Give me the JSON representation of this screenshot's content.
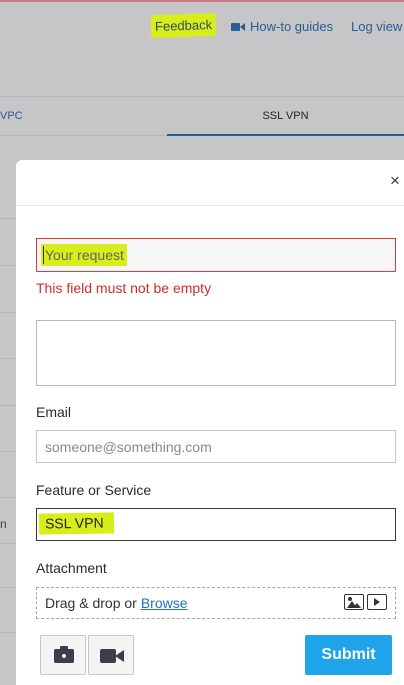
{
  "header": {
    "links": {
      "feedback": "Feedback",
      "guides": "How-to guides",
      "log": "Log view"
    }
  },
  "tabs": {
    "vpc": "VPC",
    "ssl_vpn": "SSL VPN"
  },
  "background": {
    "partial_text": "n"
  },
  "modal": {
    "close_symbol": "×",
    "request": {
      "placeholder": "Your request",
      "error": "This field must not be empty"
    },
    "description": {
      "value": ""
    },
    "email": {
      "label": "Email",
      "placeholder": "someone@something.com"
    },
    "feature": {
      "label": "Feature or Service",
      "value": "SSL VPN"
    },
    "attachment": {
      "label": "Attachment",
      "drop_text": "Drag & drop or",
      "browse": "Browse"
    },
    "submit_label": "Submit"
  },
  "colors": {
    "highlight": "#d8ee1b",
    "error": "#d22b2b",
    "submit": "#1fa4ea",
    "link": "#2a5d92"
  },
  "icons": [
    "video-icon",
    "close-icon",
    "image-icon",
    "play-icon",
    "camera-icon",
    "video-camera-icon"
  ]
}
